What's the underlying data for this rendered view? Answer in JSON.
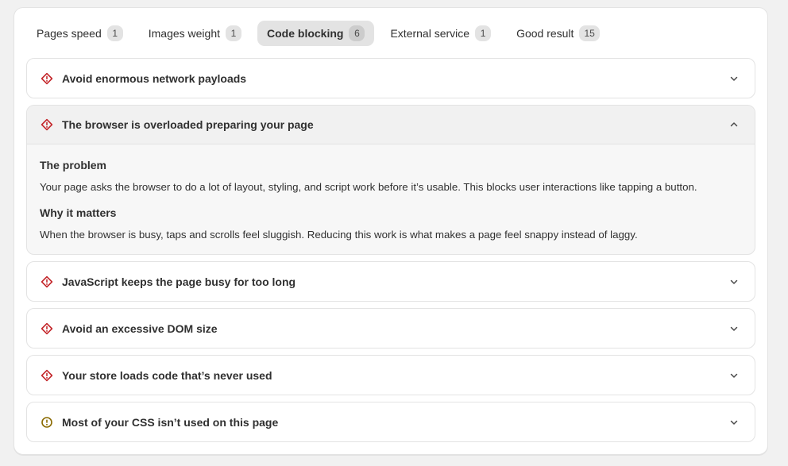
{
  "tabs": [
    {
      "label": "Pages speed",
      "count": "1",
      "active": false
    },
    {
      "label": "Images weight",
      "count": "1",
      "active": false
    },
    {
      "label": "Code blocking",
      "count": "6",
      "active": true
    },
    {
      "label": "External service",
      "count": "1",
      "active": false
    },
    {
      "label": "Good result",
      "count": "15",
      "active": false
    }
  ],
  "items": [
    {
      "title": "Avoid enormous network payloads",
      "severity": "critical",
      "open": false
    },
    {
      "title": "The browser is overloaded preparing your page",
      "severity": "critical",
      "open": true,
      "problem_heading": "The problem",
      "problem_text": "Your page asks the browser to do a lot of layout, styling, and script work before it’s usable. This blocks user interactions like tapping a button.",
      "matters_heading": "Why it matters",
      "matters_text": "When the browser is busy, taps and scrolls feel sluggish. Reducing this work is what makes a page feel snappy instead of laggy."
    },
    {
      "title": "JavaScript keeps the page busy for too long",
      "severity": "critical",
      "open": false
    },
    {
      "title": "Avoid an excessive DOM size",
      "severity": "critical",
      "open": false
    },
    {
      "title": "Your store loads code that’s never used",
      "severity": "critical",
      "open": false
    },
    {
      "title": "Most of your CSS isn’t used on this page",
      "severity": "warning",
      "open": false
    }
  ],
  "colors": {
    "critical": "#c4282c",
    "warning": "#8a6a00",
    "active_tab_bg": "#e3e3e3"
  },
  "icons": {
    "critical": "diamond-exclamation-icon",
    "warning": "circle-exclamation-icon",
    "collapsed": "chevron-down-icon",
    "expanded": "chevron-up-icon"
  }
}
